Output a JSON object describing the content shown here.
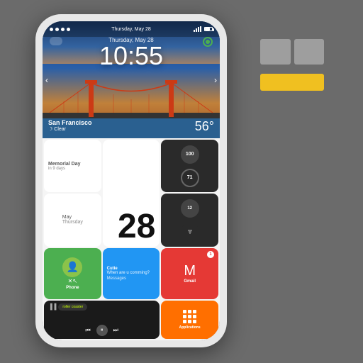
{
  "app": {
    "background": "#6b6b6b"
  },
  "logo": {
    "blocks": [
      "top-left",
      "top-right",
      "bottom-wide"
    ]
  },
  "phone": {
    "status_bar": {
      "time": "Thursday, May 28",
      "battery": "70%"
    },
    "hero": {
      "date": "Thursday, May 28",
      "time": "10:55",
      "location": "San Francisco",
      "condition": "Clear",
      "temperature": "56°"
    },
    "widgets": {
      "memorial_label": "Memorial Day",
      "memorial_sub": "in 9 days",
      "date_number": "28",
      "month": "May",
      "day": "Thursday",
      "circle1_val1": "100",
      "circle1_val2": "71",
      "circle2_val": "12",
      "phone_label": "Phone",
      "messages_contact": "Cutie",
      "messages_text": "When are u comming?",
      "messages_label": "Messages",
      "gmail_label": "Gmail",
      "gmail_count": "1",
      "song_name": "roller coaster",
      "apps_label": "Applications"
    }
  }
}
